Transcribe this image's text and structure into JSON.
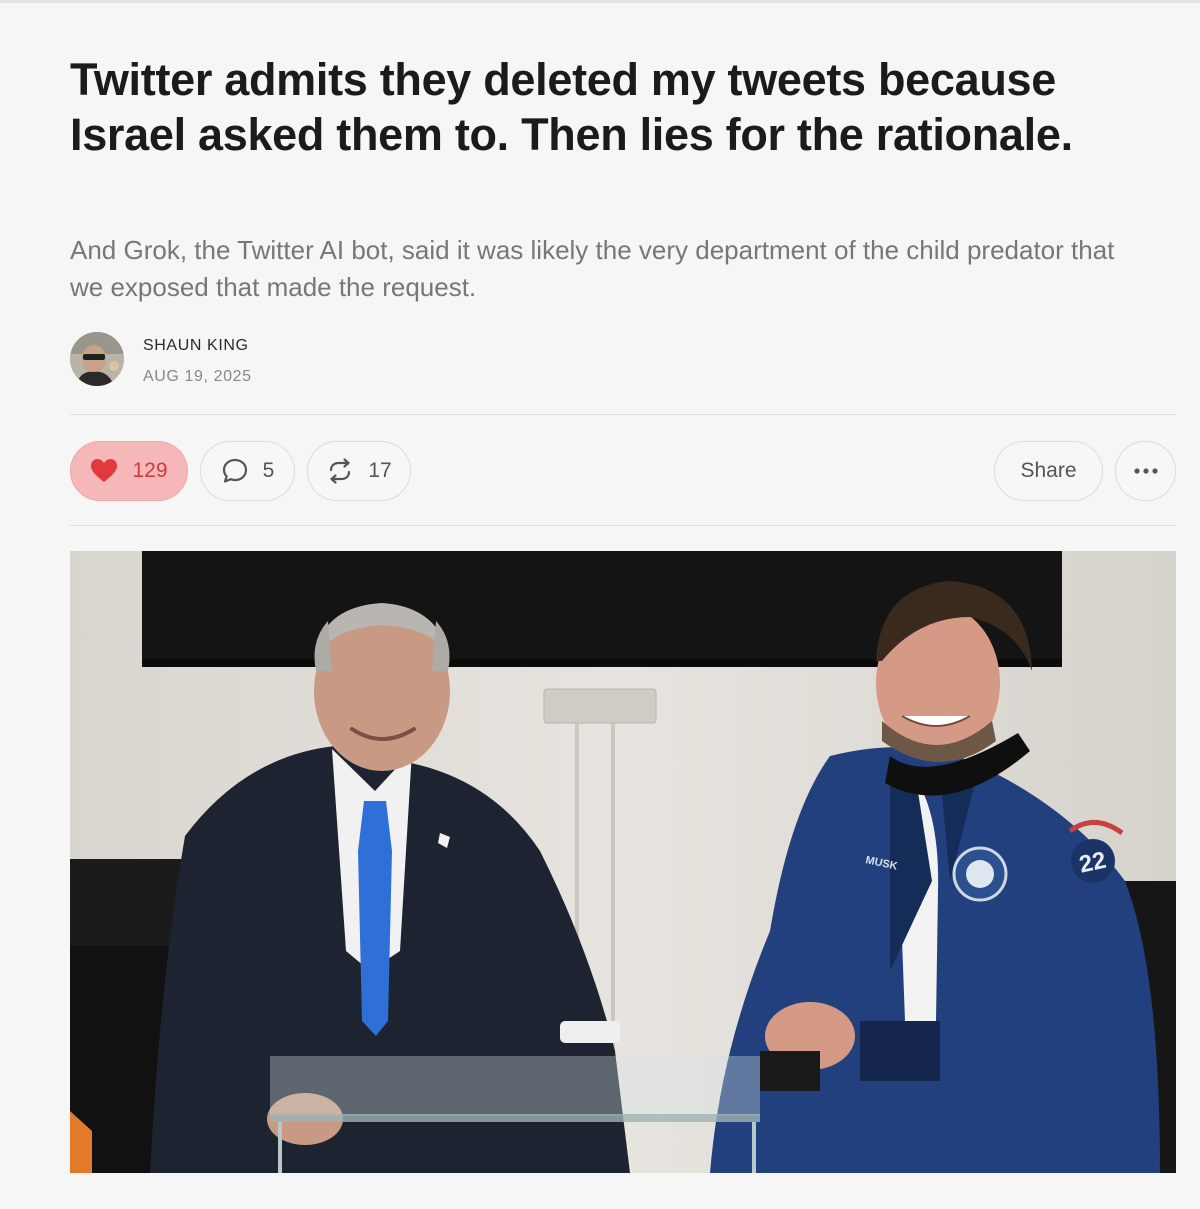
{
  "article": {
    "title": "Twitter admits they deleted my tweets because Israel asked them to. Then lies for the rationale.",
    "subtitle": "And Grok, the Twitter AI bot, said it was likely the very department of the child predator that we exposed that made the request.",
    "author": "SHAUN KING",
    "date": "AUG 19, 2025"
  },
  "actions": {
    "likes": {
      "count": "129",
      "icon": "heart-icon",
      "color": "#e0393e"
    },
    "comments": {
      "count": "5",
      "icon": "comment-icon"
    },
    "restacks": {
      "count": "17",
      "icon": "restack-icon"
    },
    "share_label": "Share",
    "more_icon": "ellipsis-icon"
  },
  "hero_image": {
    "jacket_name_patch": "MUSK",
    "sleeve_number": "22"
  }
}
